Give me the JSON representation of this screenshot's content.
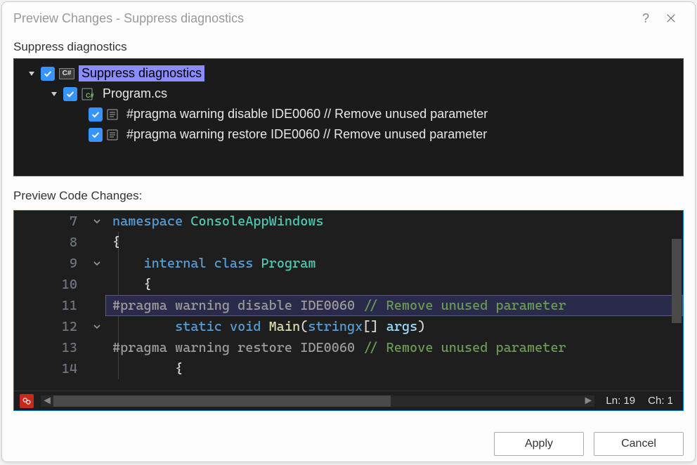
{
  "dialog": {
    "title": "Preview Changes - Suppress diagnostics",
    "help_label": "?",
    "close_label": "✕"
  },
  "tree": {
    "section_label": "Suppress diagnostics",
    "root": {
      "label": "Suppress diagnostics",
      "checked": true,
      "expanded": true
    },
    "file": {
      "label": "Program.cs",
      "checked": true,
      "expanded": true,
      "icon_text": "C#"
    },
    "items": [
      {
        "label": "#pragma warning disable IDE0060 // Remove unused parameter",
        "checked": true
      },
      {
        "label": "#pragma warning restore IDE0060 // Remove unused parameter",
        "checked": true
      }
    ]
  },
  "code": {
    "section_label": "Preview Code Changes:",
    "lines": [
      {
        "num": 7,
        "fold": "open",
        "tokens": [
          [
            "kw",
            "namespace"
          ],
          [
            "",
            ""
          ],
          [
            "type",
            " ConsoleAppWindows"
          ]
        ]
      },
      {
        "num": 8,
        "fold": "",
        "tokens": [
          [
            "punct",
            "{"
          ]
        ]
      },
      {
        "num": 9,
        "fold": "open",
        "tokens": [
          [
            "",
            "    "
          ],
          [
            "kw",
            "internal"
          ],
          [
            "",
            " "
          ],
          [
            "kw",
            "class"
          ],
          [
            "",
            " "
          ],
          [
            "type",
            "Program"
          ]
        ]
      },
      {
        "num": 10,
        "fold": "",
        "tokens": [
          [
            "",
            "    "
          ],
          [
            "punct",
            "{"
          ]
        ]
      },
      {
        "num": 11,
        "fold": "",
        "highlighted": true,
        "tokens": [
          [
            "pragma",
            "#pragma warning disable IDE0060 "
          ],
          [
            "comment",
            "// Remove unused parameter"
          ]
        ]
      },
      {
        "num": 12,
        "fold": "open",
        "tokens": [
          [
            "",
            "        "
          ],
          [
            "kw",
            "static"
          ],
          [
            "",
            " "
          ],
          [
            "kw",
            "void"
          ],
          [
            "",
            " "
          ],
          [
            "func",
            "Main"
          ],
          [
            "punct",
            "("
          ],
          [
            "kw",
            "stringx"
          ],
          [
            "punct",
            "[] "
          ],
          [
            "param",
            "args"
          ],
          [
            "punct",
            ")"
          ]
        ]
      },
      {
        "num": 13,
        "fold": "",
        "tokens": [
          [
            "pragma",
            "#pragma warning restore IDE0060 "
          ],
          [
            "comment",
            "// Remove unused parameter"
          ]
        ]
      },
      {
        "num": 14,
        "fold": "",
        "tokens": [
          [
            "",
            "        "
          ],
          [
            "punct",
            "{"
          ]
        ]
      }
    ],
    "status": {
      "line_label": "Ln: 19",
      "col_label": "Ch: 1"
    }
  },
  "buttons": {
    "apply": "Apply",
    "cancel": "Cancel"
  }
}
